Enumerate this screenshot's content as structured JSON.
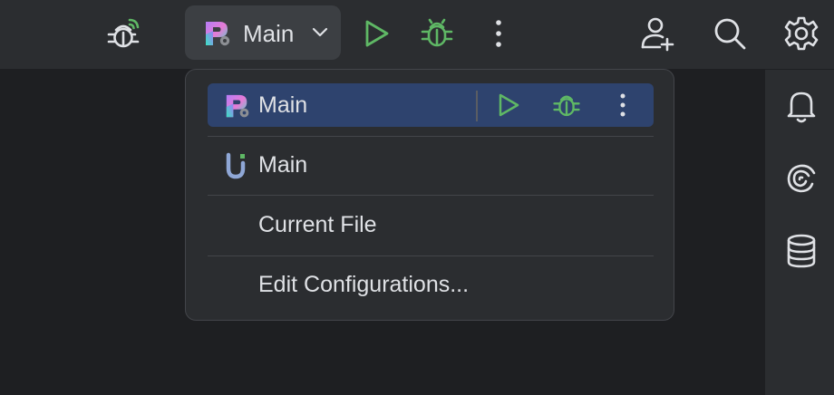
{
  "toolbar": {
    "run_config_name": "Main",
    "icons": [
      "debug-bug-wireless-icon",
      "run-config-logo-icon",
      "chevron-down-icon",
      "run-icon",
      "debug-icon",
      "more-vertical-icon",
      "add-user-icon",
      "search-icon",
      "gear-icon"
    ]
  },
  "popup": {
    "items": [
      {
        "label": "Main",
        "icon": "gradient-p-config-icon",
        "selected": true
      },
      {
        "label": "Main",
        "icon": "u-config-icon",
        "selected": false
      },
      {
        "label": "Current File",
        "icon": "",
        "selected": false
      },
      {
        "label": "Edit Configurations...",
        "icon": "",
        "selected": false
      }
    ]
  },
  "right_strip": {
    "icons": [
      "notifications-bell-icon",
      "ai-spiral-icon",
      "database-icon"
    ]
  },
  "colors": {
    "toolbar_bg": "#2b2d30",
    "editor_bg": "#1e1f22",
    "selection": "#2e436e",
    "run_green": "#5fb865",
    "text": "#dfe1e5"
  }
}
